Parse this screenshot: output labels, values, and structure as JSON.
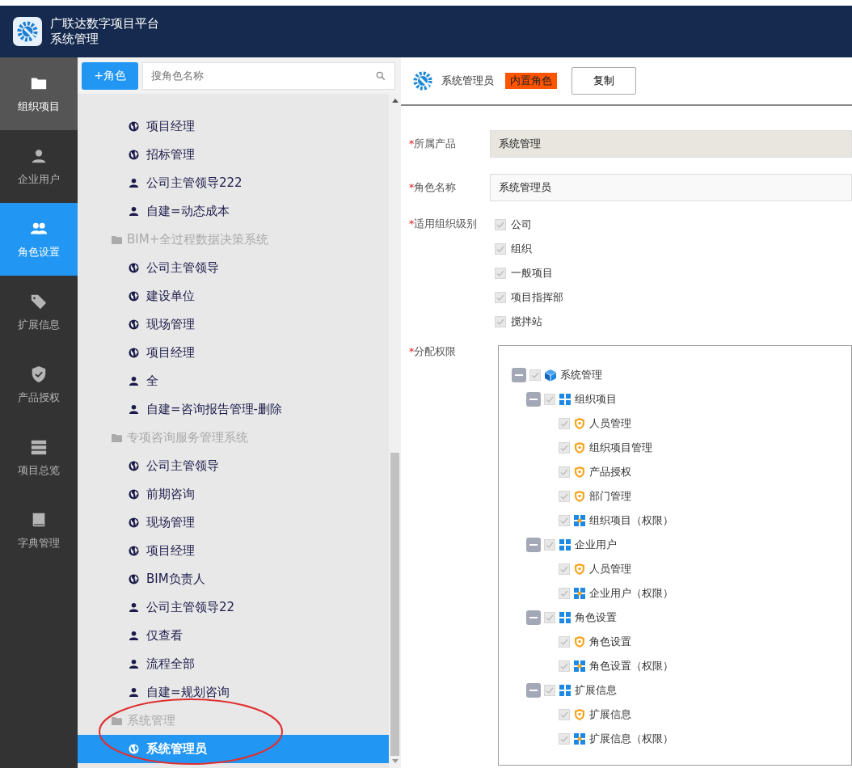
{
  "header": {
    "title": "广联达数字项目平台",
    "subtitle": "系统管理"
  },
  "nav": [
    {
      "label": "组织项目",
      "selected": false,
      "hovered": true
    },
    {
      "label": "企业用户",
      "selected": false,
      "hovered": false
    },
    {
      "label": "角色设置",
      "selected": true,
      "hovered": false
    },
    {
      "label": "扩展信息",
      "selected": false,
      "hovered": false
    },
    {
      "label": "产品授权",
      "selected": false,
      "hovered": false
    },
    {
      "label": "项目总览",
      "selected": false,
      "hovered": false
    },
    {
      "label": "字典管理",
      "selected": false,
      "hovered": false
    }
  ],
  "role_panel": {
    "add_button": "+角色",
    "search": {
      "placeholder": "搜角色名称"
    },
    "groups": [
      {
        "children": [
          {
            "label": "项目经理",
            "kind": "globe",
            "selected": false
          },
          {
            "label": "招标管理",
            "kind": "globe",
            "selected": false
          },
          {
            "label": "公司主管领导222",
            "kind": "person",
            "selected": false
          },
          {
            "label": "自建=动态成本",
            "kind": "person",
            "selected": false
          }
        ]
      },
      {
        "name": "BIM+全过程数据决策系统",
        "children": [
          {
            "label": "公司主管领导",
            "kind": "globe",
            "selected": false
          },
          {
            "label": "建设单位",
            "kind": "globe",
            "selected": false
          },
          {
            "label": "现场管理",
            "kind": "globe",
            "selected": false
          },
          {
            "label": "项目经理",
            "kind": "globe",
            "selected": false
          },
          {
            "label": "全",
            "kind": "person",
            "selected": false
          },
          {
            "label": "自建=咨询报告管理-删除",
            "kind": "person",
            "selected": false
          }
        ]
      },
      {
        "name": "专项咨询服务管理系统",
        "children": [
          {
            "label": "公司主管领导",
            "kind": "globe",
            "selected": false
          },
          {
            "label": "前期咨询",
            "kind": "globe",
            "selected": false
          },
          {
            "label": "现场管理",
            "kind": "globe",
            "selected": false
          },
          {
            "label": "项目经理",
            "kind": "globe",
            "selected": false
          },
          {
            "label": "BIM负责人",
            "kind": "globe",
            "selected": false
          },
          {
            "label": "公司主管领导22",
            "kind": "person",
            "selected": false
          },
          {
            "label": "仅查看",
            "kind": "person",
            "selected": false
          },
          {
            "label": "流程全部",
            "kind": "person",
            "selected": false
          },
          {
            "label": "自建=规划咨询",
            "kind": "person",
            "selected": false
          }
        ]
      },
      {
        "name": "系统管理",
        "children": [
          {
            "label": "系统管理员",
            "kind": "globe",
            "selected": true
          }
        ]
      }
    ]
  },
  "detail": {
    "title": "系统管理员",
    "badge": "内置角色",
    "copy_button": "复制",
    "fields": [
      {
        "required_mark": "*",
        "label": "所属产品",
        "value": "系统管理",
        "disabled": true
      },
      {
        "required_mark": "*",
        "label": "角色名称",
        "value": "系统管理员",
        "disabled": false
      }
    ],
    "levels": {
      "required_mark": "*",
      "label": "适用组织级别",
      "options": [
        {
          "label": "公司",
          "checked": true
        },
        {
          "label": "组织",
          "checked": true
        },
        {
          "label": "一般项目",
          "checked": true
        },
        {
          "label": "项目指挥部",
          "checked": true
        },
        {
          "label": "搅拌站",
          "checked": true
        }
      ]
    },
    "permissions": {
      "required_mark": "*",
      "label": "分配权限",
      "tree": [
        {
          "label": "系统管理",
          "kind": "product",
          "checked": true,
          "expanded": true,
          "children": [
            {
              "label": "组织项目",
              "kind": "module",
              "checked": true,
              "expanded": true,
              "children": [
                {
                  "label": "人员管理",
                  "kind": "function",
                  "checked": true
                },
                {
                  "label": "组织项目管理",
                  "kind": "function",
                  "checked": true
                },
                {
                  "label": "产品授权",
                  "kind": "function",
                  "checked": true
                },
                {
                  "label": "部门管理",
                  "kind": "function",
                  "checked": true
                },
                {
                  "label": "组织项目（权限）",
                  "kind": "permission",
                  "checked": true
                }
              ]
            },
            {
              "label": "企业用户",
              "kind": "module",
              "checked": true,
              "expanded": true,
              "children": [
                {
                  "label": "人员管理",
                  "kind": "function",
                  "checked": true
                },
                {
                  "label": "企业用户（权限）",
                  "kind": "permission",
                  "checked": true
                }
              ]
            },
            {
              "label": "角色设置",
              "kind": "module",
              "checked": true,
              "expanded": true,
              "children": [
                {
                  "label": "角色设置",
                  "kind": "function",
                  "checked": true
                },
                {
                  "label": "角色设置（权限）",
                  "kind": "permission",
                  "checked": true
                }
              ]
            },
            {
              "label": "扩展信息",
              "kind": "module",
              "checked": true,
              "expanded": true,
              "children": [
                {
                  "label": "扩展信息",
                  "kind": "function",
                  "checked": true
                },
                {
                  "label": "扩展信息（权限）",
                  "kind": "permission",
                  "checked": true
                }
              ]
            }
          ]
        }
      ]
    }
  }
}
